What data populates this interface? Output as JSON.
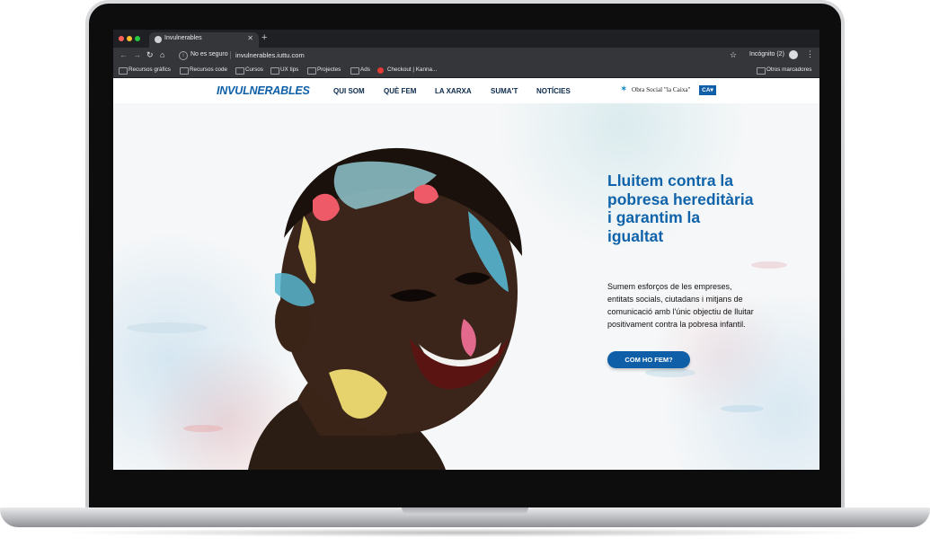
{
  "browser": {
    "tab_title": "Invulnerables",
    "new_tab": "+",
    "security_label": "No es seguro",
    "url": "invulnerables.iuttu.com",
    "incognito_label": "Incógnito (2)",
    "bookmarks": [
      {
        "label": "Recursos gràfics",
        "icon": "folder-icon"
      },
      {
        "label": "Recursos code",
        "icon": "folder-icon"
      },
      {
        "label": "Cursos",
        "icon": "folder-icon"
      },
      {
        "label": "UX tips",
        "icon": "folder-icon"
      },
      {
        "label": "Projectes",
        "icon": "folder-icon"
      },
      {
        "label": "Ads",
        "icon": "folder-icon"
      },
      {
        "label": "Checkout | Kanna...",
        "icon": "site-favicon"
      }
    ],
    "other_bookmarks": "Otros marcadores"
  },
  "site": {
    "logo": "INVULNERABLES",
    "nav": [
      "QUI SOM",
      "QUÈ FEM",
      "LA XARXA",
      "SUMA'T",
      "NOTÍCIES"
    ],
    "sponsor": "Obra Social \"la Caixa\"",
    "lang": "CA▾"
  },
  "hero": {
    "title": "Lluitem contra la pobresa hereditària i garantim la igualtat",
    "body": "Sumem esforços de les empreses, entitats socials, ciutadans i mitjans de comunicació amb l'únic objectiu de lluitar positivament contra la pobresa infantil.",
    "cta": "COM HO FEM?"
  },
  "colors": {
    "brand": "#0f5fa8",
    "title": "#0f63aa",
    "chrome_dark": "#35363a"
  }
}
